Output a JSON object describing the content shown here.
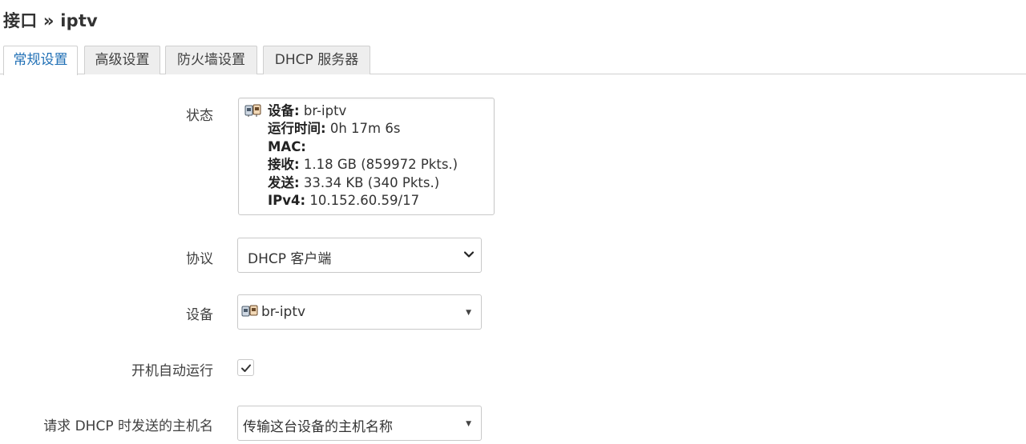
{
  "page": {
    "title": "接口 » iptv"
  },
  "tabs": [
    {
      "label": "常规设置",
      "active": true
    },
    {
      "label": "高级设置"
    },
    {
      "label": "防火墙设置"
    },
    {
      "label": "DHCP 服务器"
    }
  ],
  "status": {
    "label": "状态",
    "icon": "ethernet-ports-icon",
    "device_key": "设备:",
    "device_value": "br-iptv",
    "uptime_key": "运行时间:",
    "uptime_value": "0h 17m 6s",
    "mac_key": "MAC:",
    "rx_key": "接收:",
    "rx_value": "1.18 GB (859972 Pkts.)",
    "tx_key": "发送:",
    "tx_value": "33.34 KB (340 Pkts.)",
    "ipv4_key": "IPv4:",
    "ipv4_value": "10.152.60.59/17"
  },
  "protocol": {
    "label": "协议",
    "value": "DHCP 客户端"
  },
  "device": {
    "label": "设备",
    "value": "br-iptv",
    "icon": "ethernet-ports-icon"
  },
  "autostart": {
    "label": "开机自动运行",
    "checked": true
  },
  "hostname": {
    "label": "请求 DHCP 时发送的主机名",
    "value": "传输这台设备的主机名称"
  },
  "colors": {
    "active_tab": "#1f6fb5",
    "border": "#c9c9c9",
    "text": "#404040"
  }
}
